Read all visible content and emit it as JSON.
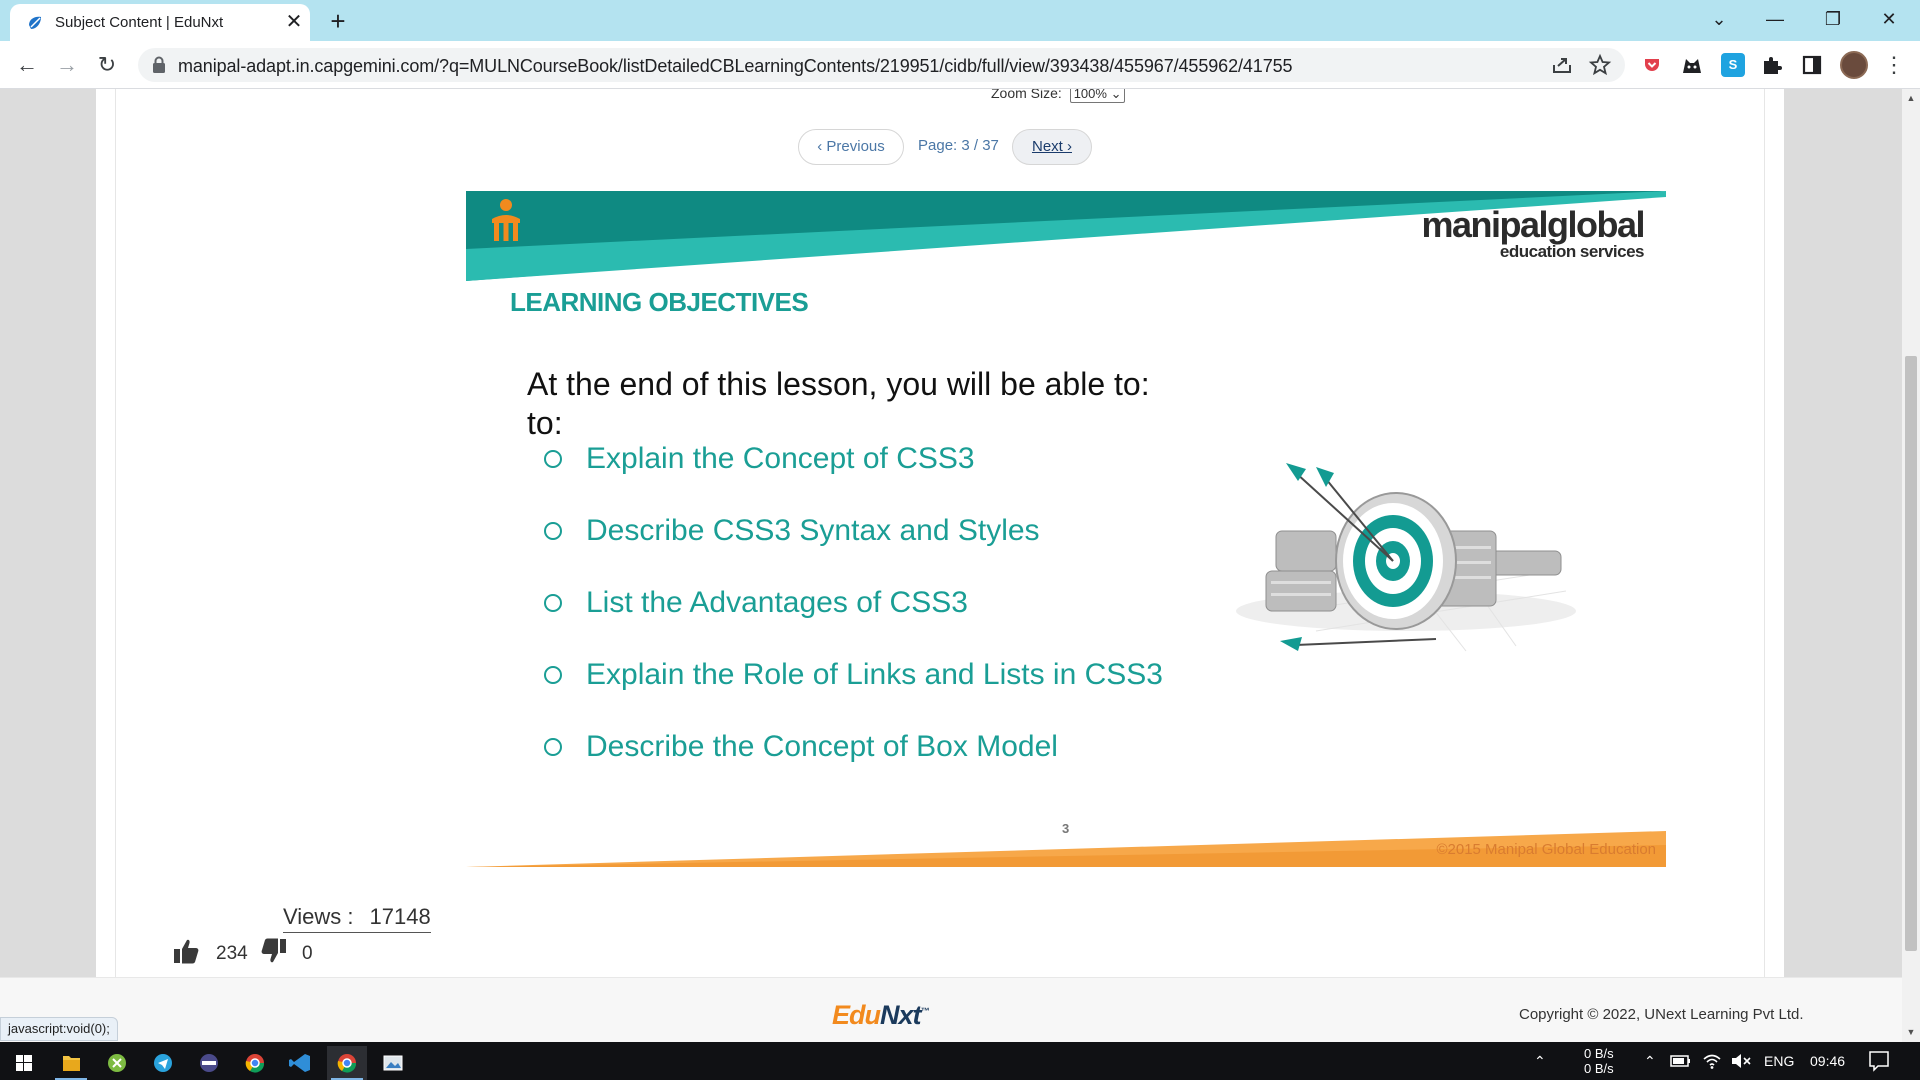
{
  "browser": {
    "tab_title": "Subject Content | EduNxt",
    "tab_close": "✕",
    "new_tab": "+",
    "url": "manipal-adapt.in.capgemini.com/?q=MULNCourseBook/listDetailedCBLearningContents/219951/cidb/full/view/393438/455967/455962/41755",
    "window_controls": {
      "chevron": "⌄",
      "minimize": "—",
      "restore": "❐",
      "close": "✕"
    },
    "nav": {
      "back": "←",
      "forward": "→",
      "reload": "↻"
    },
    "extensions": [
      "pocket-icon",
      "puzzle-icon",
      "s-icon",
      "extensions-icon",
      "sidepanel-icon"
    ]
  },
  "viewer": {
    "zoom_label": "Zoom Size:",
    "zoom_value": "100%",
    "prev_label": "‹ Previous",
    "page_label": "Page: 3 / 37",
    "next_label": "Next ›"
  },
  "slide": {
    "brand_name": "manipalglobal",
    "brand_sub": "education services",
    "title": "LEARNING OBJECTIVES",
    "intro_main": "At the end of this lesson, you will be able ",
    "intro_tail": "to:",
    "intro_line2": "to:",
    "objectives": [
      "Explain the Concept of CSS3",
      "Describe CSS3 Syntax and Styles",
      "List the Advantages of CSS3",
      "Explain the Role of Links and Lists in CSS3",
      "Describe the Concept of Box Model"
    ],
    "page_number": "3",
    "copyright": "©2015 Manipal Global Education",
    "colors": {
      "teal": "#1a9e95",
      "orange": "#f7a84a"
    }
  },
  "stats": {
    "views_label": "Views :",
    "views_count": "17148",
    "likes": "234",
    "dislikes": "0"
  },
  "footer": {
    "logo_edu": "Edu",
    "logo_nxt": "Nxt",
    "logo_tm": "™",
    "copyright": "Copyright © 2022, UNext Learning Pvt Ltd.",
    "status_text": "javascript:void(0);"
  },
  "taskbar": {
    "net_up": "0 B/s",
    "net_down": "0 B/s",
    "lang": "ENG",
    "time": "09:46"
  }
}
